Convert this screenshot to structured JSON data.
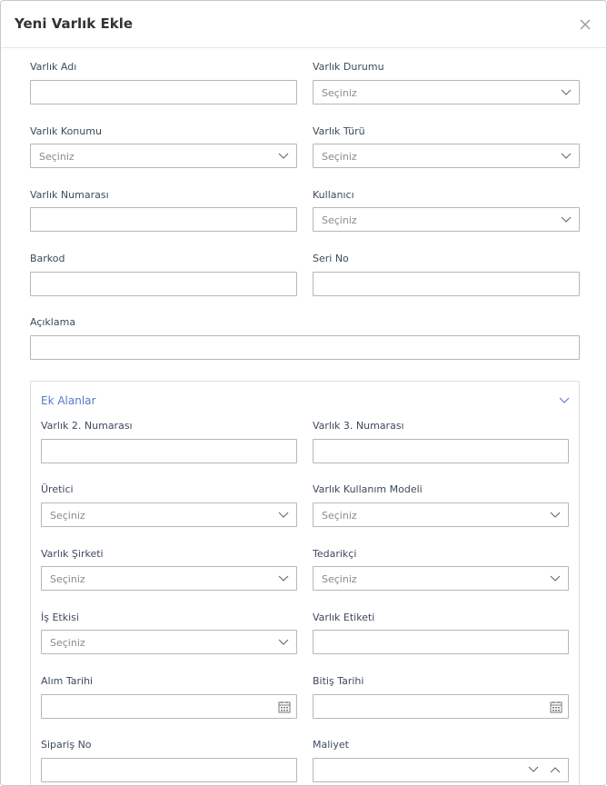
{
  "modal": {
    "title": "Yeni Varlık Ekle",
    "close_icon": "close-icon"
  },
  "fields": {
    "asset_name": {
      "label": "Varlık Adı"
    },
    "asset_status": {
      "label": "Varlık Durumu",
      "placeholder": "Seçiniz"
    },
    "asset_location": {
      "label": "Varlık Konumu",
      "placeholder": "Seçiniz"
    },
    "asset_type": {
      "label": "Varlık Türü",
      "placeholder": "Seçiniz"
    },
    "asset_number": {
      "label": "Varlık Numarası"
    },
    "user": {
      "label": "Kullanıcı",
      "placeholder": "Seçiniz"
    },
    "barcode": {
      "label": "Barkod"
    },
    "serial_no": {
      "label": "Seri No"
    },
    "description": {
      "label": "Açıklama"
    }
  },
  "extra": {
    "title": "Ek Alanlar",
    "asset_number_2": {
      "label": "Varlık 2. Numarası"
    },
    "asset_number_3": {
      "label": "Varlık 3. Numarası"
    },
    "manufacturer": {
      "label": "Üretici",
      "placeholder": "Seçiniz"
    },
    "usage_model": {
      "label": "Varlık Kullanım Modeli",
      "placeholder": "Seçiniz"
    },
    "company": {
      "label": "Varlık Şirketi",
      "placeholder": "Seçiniz"
    },
    "supplier": {
      "label": "Tedarikçi",
      "placeholder": "Seçiniz"
    },
    "business_impact": {
      "label": "İş Etkisi",
      "placeholder": "Seçiniz"
    },
    "asset_tag": {
      "label": "Varlık Etiketi"
    },
    "purchase_date": {
      "label": "Alım Tarihi"
    },
    "end_date": {
      "label": "Bitiş Tarihi"
    },
    "order_no": {
      "label": "Sipariş No"
    },
    "cost": {
      "label": "Maliyet"
    }
  },
  "colors": {
    "accent": "#5a78c8",
    "border": "#b7b7b7",
    "label": "#3c4a5e"
  }
}
